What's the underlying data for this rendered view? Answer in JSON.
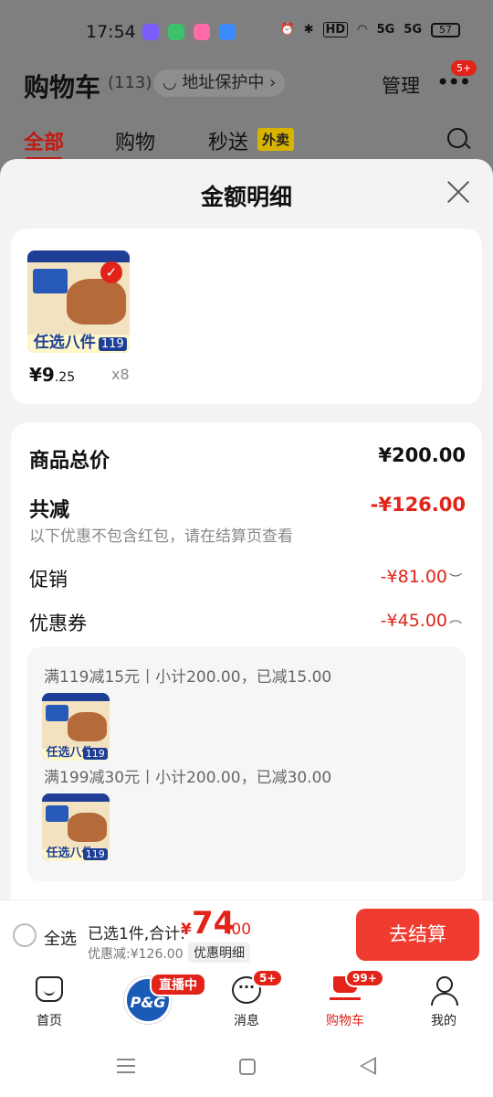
{
  "status_bar": {
    "time": "17:54",
    "hd": "HD",
    "net1": "5G",
    "net2": "5G",
    "battery": "57",
    "app_colors": [
      "#7b5cff",
      "#39c46a",
      "#ff6aa8",
      "#3a8bff"
    ]
  },
  "header": {
    "title": "购物车",
    "count": "(113)",
    "address": "◡ 地址保护中 ›",
    "manage": "管理",
    "more_badge": "5+"
  },
  "tabs": [
    {
      "label": "全部"
    },
    {
      "label": "购物"
    },
    {
      "label": "秒送"
    }
  ],
  "waimai_badge": "外卖",
  "sheet": {
    "title": "金额明细"
  },
  "item": {
    "price_int": "¥9",
    "price_dec": ".25",
    "qty": "x8",
    "image": {
      "bottom_text": "任选八件",
      "num": "119"
    }
  },
  "detail": {
    "total_label": "商品总价",
    "total_value": "¥200.00",
    "reduce_label": "共减",
    "reduce_value": "-¥126.00",
    "note": "以下优惠不包含红包，请在结算页查看",
    "promo_label": "促销",
    "promo_value": "-¥81.00",
    "coupon_label": "优惠券",
    "coupon_value": "-¥45.00",
    "coupons": [
      {
        "line": "满119减15元丨小计200.00，已减15.00"
      },
      {
        "line": "满199减30元丨小计200.00，已减30.00"
      }
    ]
  },
  "bottom_bar": {
    "select_all": "全选",
    "selected": "已选1件,合计:",
    "yen": "¥",
    "total_int": "74",
    "total_dec": ".00",
    "discount": "优惠减:¥126.00",
    "detail_pill": "优惠明细",
    "checkout": "去结算"
  },
  "nav": {
    "home": "首页",
    "live_badge": "直播中",
    "pg": "P&G",
    "msg": "消息",
    "msg_badge": "5+",
    "cart": "购物车",
    "cart_badge": "99+",
    "me": "我的"
  },
  "colors": {
    "accent": "#e2231a",
    "checkout_bg": "#ef3b30",
    "sheet_bg": "#f3f3f3",
    "dim_bg": "#7f7f7f"
  }
}
